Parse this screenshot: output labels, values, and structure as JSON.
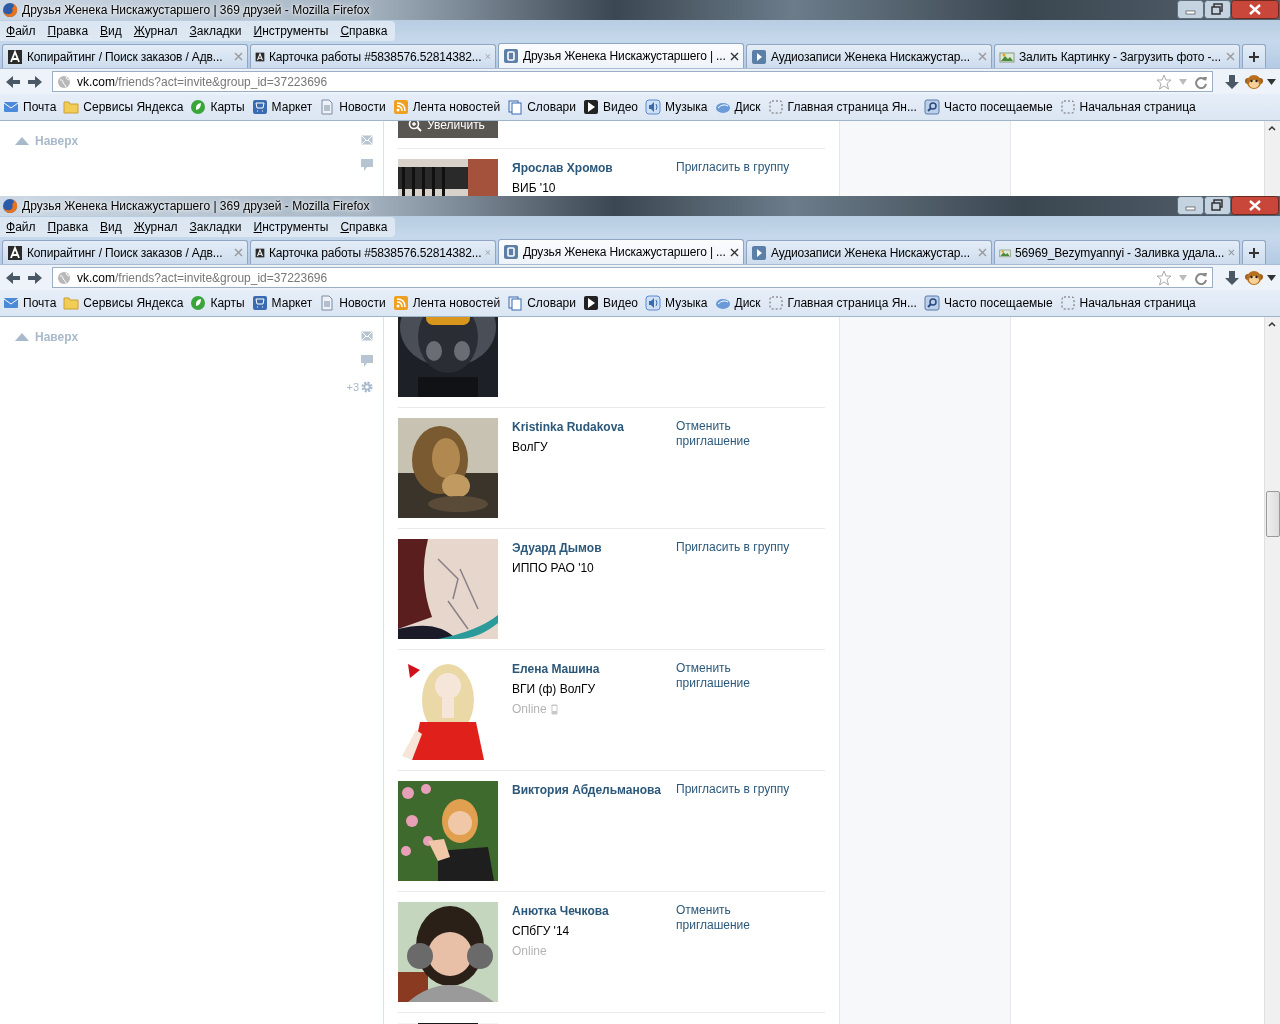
{
  "windows": [
    {
      "title": "Друзья Женека Нискажустаршего | 369 друзей - Mozilla Firefox",
      "menu": [
        "Файл",
        "Правка",
        "Вид",
        "Журнал",
        "Закладки",
        "Инструменты",
        "Справка"
      ],
      "tabs": [
        {
          "label": "Копирайтинг / Поиск заказов / Адв...",
          "selected": false
        },
        {
          "label": "Карточка работы #5838576.52814382...",
          "selected": false
        },
        {
          "label": "Друзья Женека Нискажустаршего | ...",
          "selected": true
        },
        {
          "label": "Аудиозаписи Женека Нискажустар...",
          "selected": false
        },
        {
          "label": "Залить Картинку - Загрузить фото -...",
          "selected": false
        }
      ],
      "address": {
        "host": "vk.com",
        "path": "/friends?act=invite&group_id=37223696"
      },
      "bookmarks": [
        "Почта",
        "Сервисы Яндекса",
        "Карты",
        "Маркет",
        "Новости",
        "Лента новостей",
        "Словари",
        "Видео",
        "Музыка",
        "Диск",
        "Главная страница Ян...",
        "Часто посещаемые",
        "Начальная страница"
      ],
      "sidebar": {
        "back_to_top": "Наверх"
      },
      "friends": [
        {
          "kind": "picture",
          "zoom_label": "Увеличить"
        },
        {
          "kind": "person",
          "name": "Ярослав Хромов",
          "subtitle": "ВИБ '10",
          "action": "Пригласить в группу"
        }
      ]
    },
    {
      "title": "Друзья Женека Нискажустаршего | 369 друзей - Mozilla Firefox",
      "menu": [
        "Файл",
        "Правка",
        "Вид",
        "Журнал",
        "Закладки",
        "Инструменты",
        "Справка"
      ],
      "tabs": [
        {
          "label": "Копирайтинг / Поиск заказов / Адв...",
          "selected": false
        },
        {
          "label": "Карточка работы #5838576.52814382...",
          "selected": false
        },
        {
          "label": "Друзья Женека Нискажустаршего | ...",
          "selected": true
        },
        {
          "label": "Аудиозаписи Женека Нискажустар...",
          "selected": false
        },
        {
          "label": "56969_Bezymyannyi - Заливка удала...",
          "selected": false
        }
      ],
      "address": {
        "host": "vk.com",
        "path": "/friends?act=invite&group_id=37223696"
      },
      "bookmarks": [
        "Почта",
        "Сервисы Яндекса",
        "Карты",
        "Маркет",
        "Новости",
        "Лента новостей",
        "Словари",
        "Видео",
        "Музыка",
        "Диск",
        "Главная страница Ян...",
        "Часто посещаемые",
        "Начальная страница"
      ],
      "sidebar": {
        "back_to_top": "Наверх",
        "counter": "+3"
      },
      "friends": [
        {
          "kind": "picture"
        },
        {
          "kind": "person",
          "name": "Kristinka Rudakova",
          "subtitle": "ВолГУ",
          "action": "Отменить приглашение"
        },
        {
          "kind": "person",
          "name": "Эдуард Дымов",
          "subtitle": "ИППО РАО '10",
          "action": "Пригласить в группу"
        },
        {
          "kind": "person",
          "name": "Елена Машина",
          "subtitle": "ВГИ (ф) ВолГУ",
          "online": "Online",
          "mobile": true,
          "action": "Отменить приглашение"
        },
        {
          "kind": "person",
          "name": "Виктория Абдельманова",
          "action": "Пригласить в группу"
        },
        {
          "kind": "person",
          "name": "Анютка Чечкова",
          "subtitle": "СПбГУ '14",
          "online": "Online",
          "mobile": false,
          "action": "Отменить приглашение"
        },
        {
          "kind": "picture"
        }
      ]
    }
  ]
}
